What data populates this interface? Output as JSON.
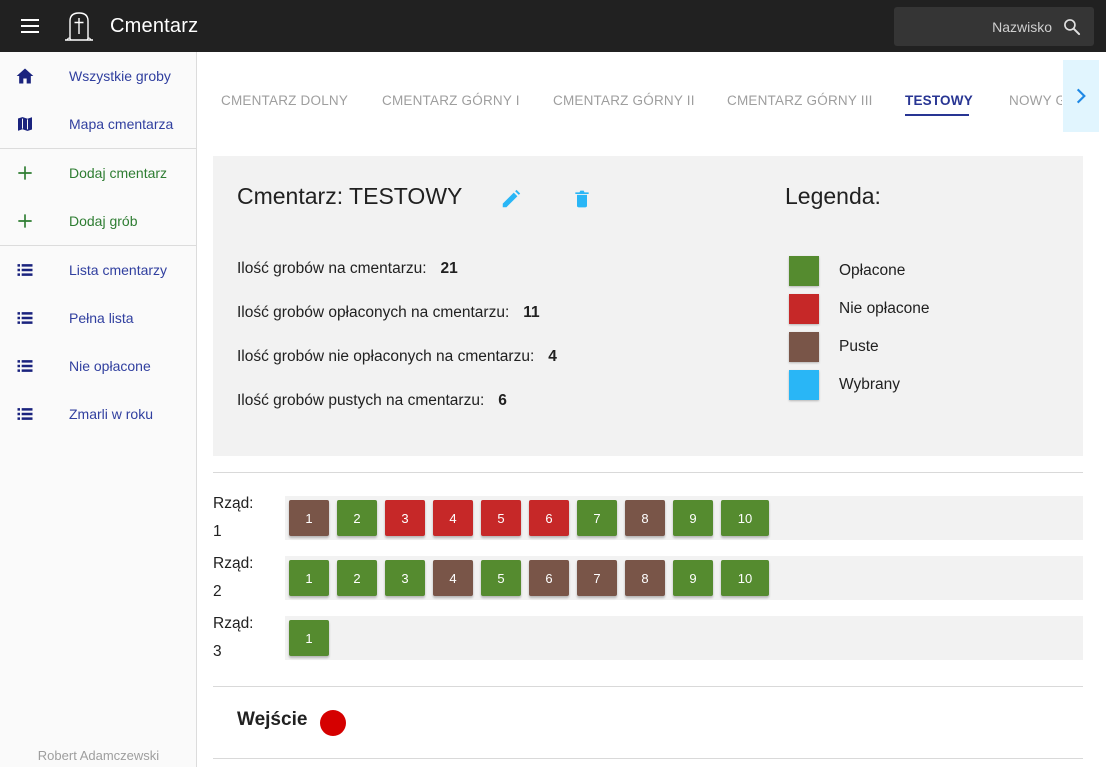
{
  "app": {
    "title": "Cmentarz"
  },
  "search": {
    "placeholder": "Nazwisko"
  },
  "sidebar": {
    "items": [
      {
        "label": "Wszystkie groby",
        "icon": "home-icon",
        "color": "purple"
      },
      {
        "label": "Mapa cmentarza",
        "icon": "map-icon",
        "color": "purple"
      },
      {
        "label": "Dodaj cmentarz",
        "icon": "plus-icon",
        "color": "green"
      },
      {
        "label": "Dodaj grób",
        "icon": "plus-icon",
        "color": "green"
      },
      {
        "label": "Lista cmentarzy",
        "icon": "list-icon",
        "color": "purple"
      },
      {
        "label": "Pełna lista",
        "icon": "list-icon",
        "color": "purple"
      },
      {
        "label": "Nie opłacone",
        "icon": "list-icon",
        "color": "purple"
      },
      {
        "label": "Zmarli w roku",
        "icon": "list-icon",
        "color": "purple"
      }
    ],
    "author": "Robert Adamczewski"
  },
  "tabs": [
    {
      "label": "CMENTARZ DOLNY",
      "active": false
    },
    {
      "label": "CMENTARZ GÓRNY I",
      "active": false
    },
    {
      "label": "CMENTARZ GÓRNY II",
      "active": false
    },
    {
      "label": "CMENTARZ GÓRNY III",
      "active": false
    },
    {
      "label": "TESTOWY",
      "active": true
    },
    {
      "label": "NOWY G",
      "active": false
    }
  ],
  "cemetery": {
    "title": "Cmentarz: TESTOWY",
    "stats": [
      {
        "label": "Ilość grobów na cmentarzu:",
        "value": "21"
      },
      {
        "label": "Ilość grobów opłaconych na cmentarzu:",
        "value": "11"
      },
      {
        "label": "Ilość grobów nie opłaconych na cmentarzu:",
        "value": "4"
      },
      {
        "label": "Ilość grobów pustych na cmentarzu:",
        "value": "6"
      }
    ]
  },
  "legend": {
    "title": "Legenda:",
    "items": [
      {
        "label": "Opłacone",
        "color": "#558b2f"
      },
      {
        "label": "Nie opłacone",
        "color": "#c62828"
      },
      {
        "label": "Puste",
        "color": "#795548"
      },
      {
        "label": "Wybrany",
        "color": "#29b6f6"
      }
    ]
  },
  "rows": [
    {
      "label": "Rząd:",
      "number": "1",
      "graves": [
        {
          "n": "1",
          "status": "Puste"
        },
        {
          "n": "2",
          "status": "Opłacone"
        },
        {
          "n": "3",
          "status": "Nie opłacone"
        },
        {
          "n": "4",
          "status": "Nie opłacone"
        },
        {
          "n": "5",
          "status": "Nie opłacone"
        },
        {
          "n": "6",
          "status": "Nie opłacone"
        },
        {
          "n": "7",
          "status": "Opłacone"
        },
        {
          "n": "8",
          "status": "Puste"
        },
        {
          "n": "9",
          "status": "Opłacone"
        },
        {
          "n": "10",
          "status": "Opłacone"
        }
      ]
    },
    {
      "label": "Rząd:",
      "number": "2",
      "graves": [
        {
          "n": "1",
          "status": "Opłacone"
        },
        {
          "n": "2",
          "status": "Opłacone"
        },
        {
          "n": "3",
          "status": "Opłacone"
        },
        {
          "n": "4",
          "status": "Puste"
        },
        {
          "n": "5",
          "status": "Opłacone"
        },
        {
          "n": "6",
          "status": "Puste"
        },
        {
          "n": "7",
          "status": "Puste"
        },
        {
          "n": "8",
          "status": "Puste"
        },
        {
          "n": "9",
          "status": "Opłacone"
        },
        {
          "n": "10",
          "status": "Opłacone"
        }
      ]
    },
    {
      "label": "Rząd:",
      "number": "3",
      "graves": [
        {
          "n": "1",
          "status": "Opłacone"
        }
      ]
    }
  ],
  "entrance": {
    "label": "Wejście",
    "color": "#d50000"
  },
  "colors": {
    "topbar": "#212121",
    "accent": "#283593",
    "action": "#29b6f6"
  }
}
